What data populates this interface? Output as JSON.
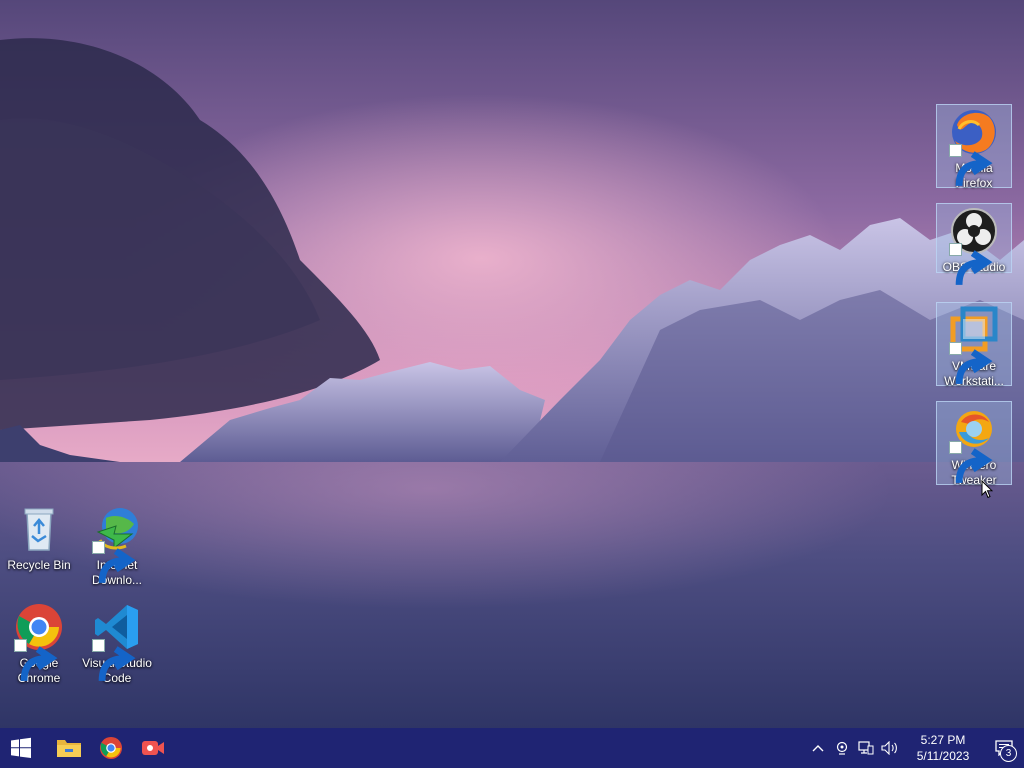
{
  "desktop": {
    "left_icons": [
      {
        "label": "Recycle Bin",
        "icon": "recycle-bin-icon",
        "shortcut": false
      },
      {
        "label": "Internet Downlo...",
        "icon": "idm-icon",
        "shortcut": true
      },
      {
        "label": "Google Chrome",
        "icon": "chrome-icon",
        "shortcut": true
      },
      {
        "label": "Visual Studio Code",
        "icon": "vscode-icon",
        "shortcut": true
      }
    ],
    "right_icons": [
      {
        "label": "Mozilla Firefox",
        "icon": "firefox-icon",
        "selected": true
      },
      {
        "label": "OBS Studio",
        "icon": "obs-icon",
        "selected": true
      },
      {
        "label": "VMware Workstati...",
        "icon": "vmware-icon",
        "selected": true
      },
      {
        "label": "Winaero Tweaker",
        "icon": "winaero-icon",
        "selected": true
      }
    ]
  },
  "taskbar": {
    "pinned": [
      "start-icon",
      "file-explorer-icon",
      "chrome-icon",
      "screen-recorder-icon"
    ],
    "tray_icons": [
      "chevron-up-icon",
      "meet-now-icon",
      "network-icon",
      "volume-icon"
    ],
    "clock": {
      "time": "5:27 PM",
      "date": "5/11/2023"
    },
    "notification_count": "3"
  },
  "colors": {
    "taskbar": "#1f2473",
    "sky_top": "#5e4d7e",
    "sky_glow": "#e3a2c6",
    "water": "#3d4374",
    "selection": "#a0bee6"
  }
}
